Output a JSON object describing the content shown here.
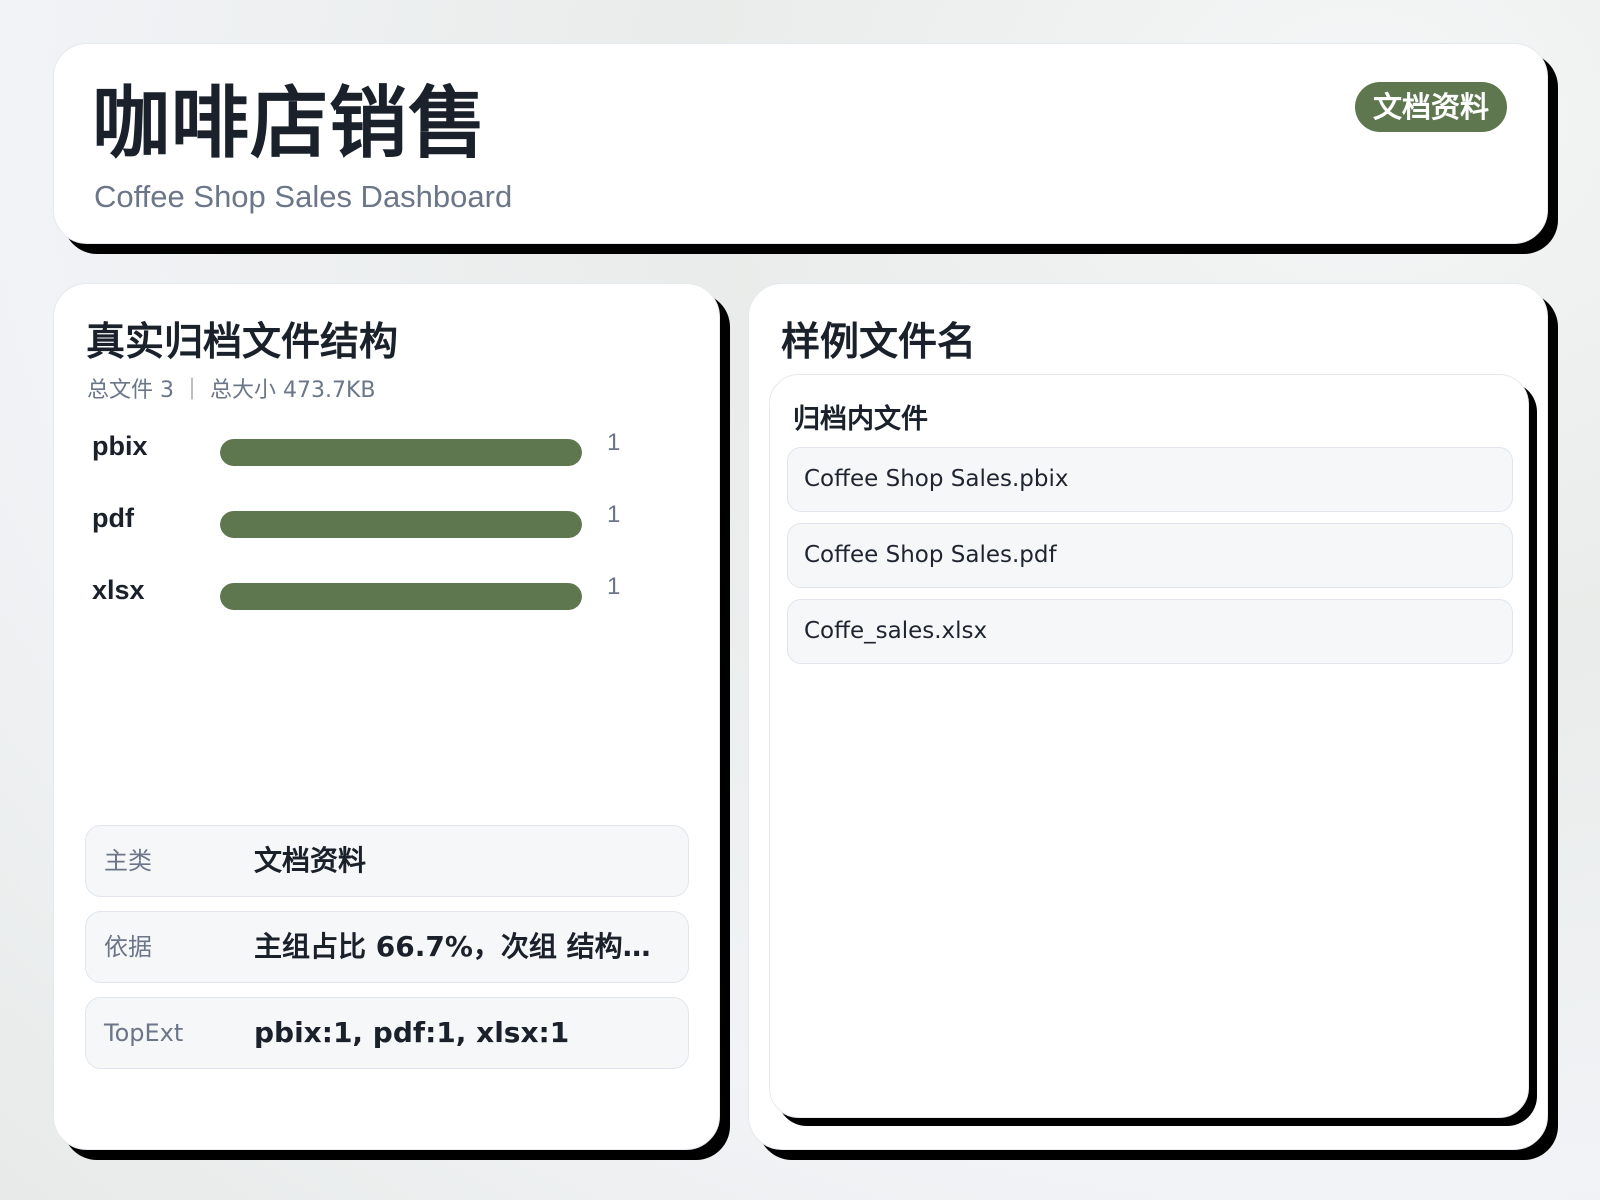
{
  "header": {
    "title": "咖啡店销售",
    "subtitle": "Coffee Shop Sales Dashboard",
    "badge": "文档资料"
  },
  "structure": {
    "title": "真实归档文件结构",
    "stats": "总文件 3 ｜ 总大小 473.7KB",
    "extensions": [
      {
        "label": "pbix",
        "count": "1",
        "fraction": 1.0
      },
      {
        "label": "pdf",
        "count": "1",
        "fraction": 1.0
      },
      {
        "label": "xlsx",
        "count": "1",
        "fraction": 1.0
      }
    ],
    "info": [
      {
        "key": "主类",
        "value": "文档资料"
      },
      {
        "key": "依据",
        "value": "主组占比 66.7%，次组 结构化..."
      },
      {
        "key": "TopExt",
        "value": "pbix:1, pdf:1, xlsx:1"
      }
    ]
  },
  "samples": {
    "title": "样例文件名",
    "panel_title": "归档内文件",
    "files": [
      "Coffee Shop Sales.pbix",
      "Coffee Shop Sales.pdf",
      "Coffe_sales.xlsx"
    ]
  },
  "colors": {
    "accent": "#5e774f",
    "text": "#1a212b",
    "muted": "#6b7688"
  }
}
